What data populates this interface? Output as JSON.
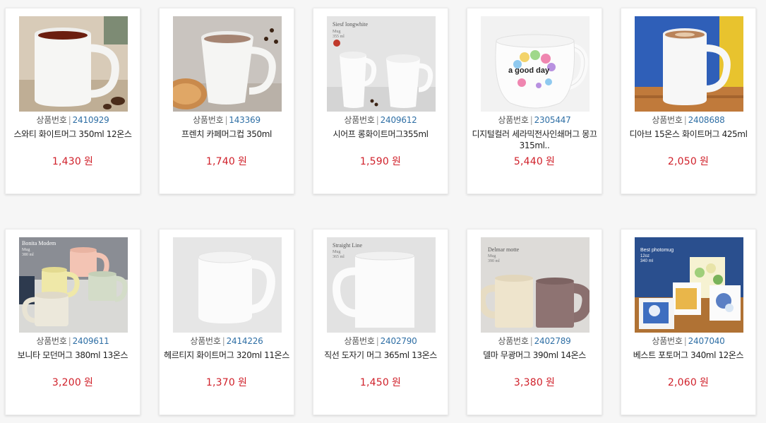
{
  "code_label": "상품번호",
  "code_separator": "|",
  "currency_unit": "원",
  "products": [
    {
      "code": "2410929",
      "name": "스와티 화이트머그 350ml 12온스",
      "price": "1,430",
      "image_text": []
    },
    {
      "code": "143369",
      "name": "프렌치 카페머그컵 350ml",
      "price": "1,740",
      "image_text": []
    },
    {
      "code": "2409612",
      "name": "시어프 롱화이트머그355ml",
      "price": "1,590",
      "image_text": [
        "Siesf longwhite",
        "Mug",
        "355 ml"
      ]
    },
    {
      "code": "2305447",
      "name": "디지털컬러 세라믹전사인쇄머그 몽끄 315ml..",
      "price": "5,440",
      "image_text": [
        "a good day"
      ]
    },
    {
      "code": "2408688",
      "name": "디아브 15온스 화이트머그 425ml",
      "price": "2,050",
      "image_text": []
    },
    {
      "code": "2409611",
      "name": "보니타 모던머그 380ml 13온스",
      "price": "3,200",
      "image_text": [
        "Bonita Modem",
        "Mug",
        "380 ml"
      ]
    },
    {
      "code": "2414226",
      "name": "헤르티지 화이트머그 320ml 11온스",
      "price": "1,370",
      "image_text": []
    },
    {
      "code": "2402790",
      "name": "직선 도자기 머그 365ml 13온스",
      "price": "1,450",
      "image_text": [
        "Straight Line",
        "Mug",
        "365 ml"
      ]
    },
    {
      "code": "2402789",
      "name": "델마 무광머그 390ml 14온스",
      "price": "3,380",
      "image_text": [
        "Delmar motte",
        "Mug",
        "390 ml"
      ]
    },
    {
      "code": "2407040",
      "name": "베스트 포토머그 340ml 12온스",
      "price": "2,060",
      "image_text": [
        "Best photomug",
        "12oz",
        "340 ml"
      ]
    }
  ]
}
